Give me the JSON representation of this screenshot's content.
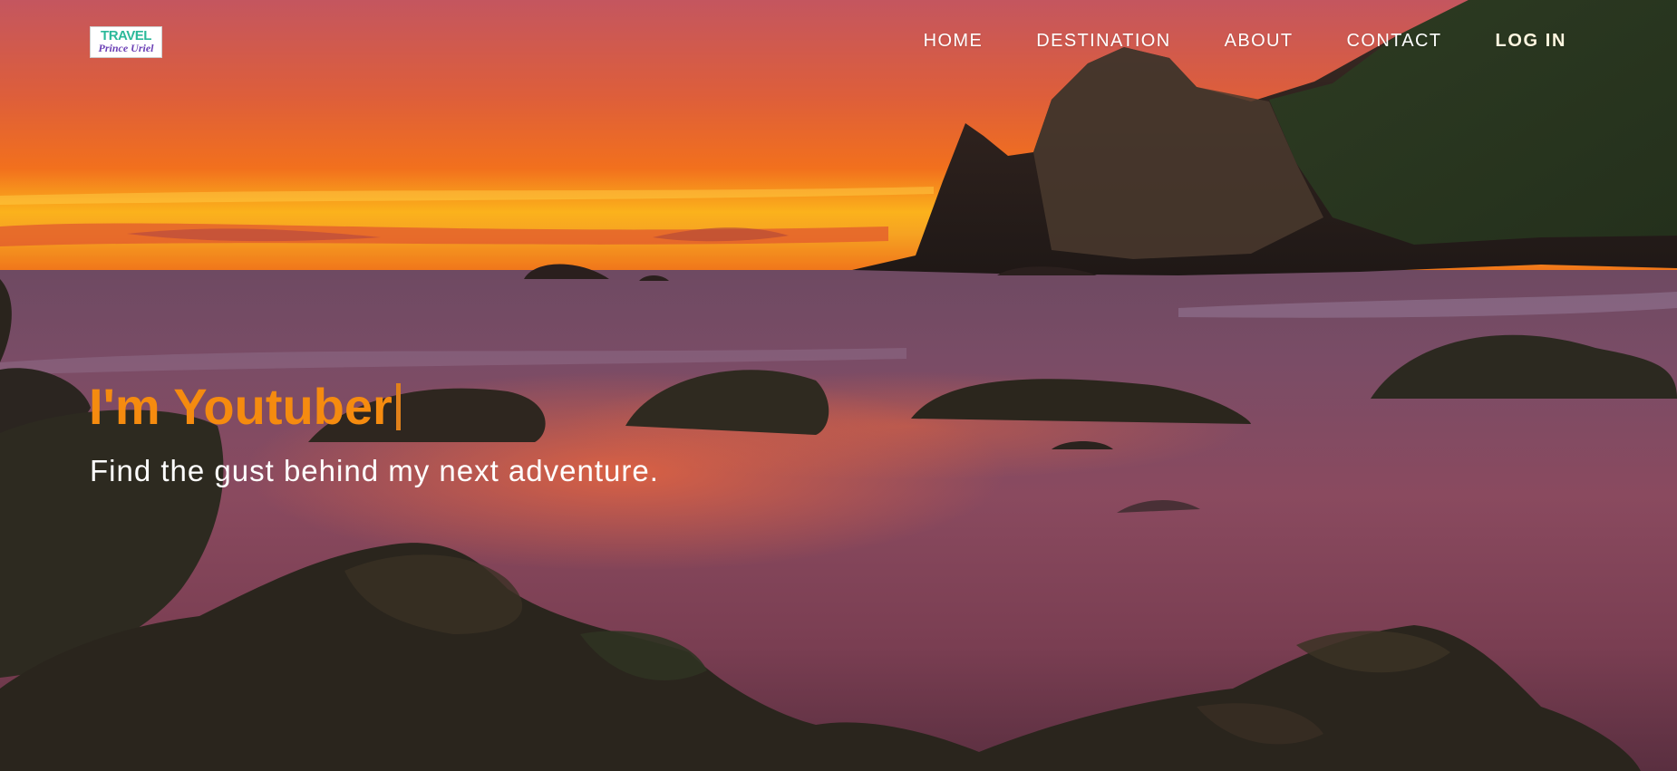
{
  "brand": {
    "logo_top": "TRAVEL",
    "logo_bottom": "Prince Uriel",
    "colors": {
      "logo_top": "#2bb99a",
      "logo_bottom": "#6b3fb5"
    }
  },
  "nav": {
    "items": [
      {
        "label": "HOME"
      },
      {
        "label": "DESTINATION"
      },
      {
        "label": "ABOUT"
      },
      {
        "label": "CONTACT"
      }
    ],
    "login_label": "LOG IN"
  },
  "hero": {
    "headline": "I'm Youtuber",
    "subtitle": "Find the gust behind my next adventure.",
    "background": "sunset-beach-photo",
    "colors": {
      "headline": "#f58b0f",
      "subtitle": "#ffffff"
    }
  }
}
